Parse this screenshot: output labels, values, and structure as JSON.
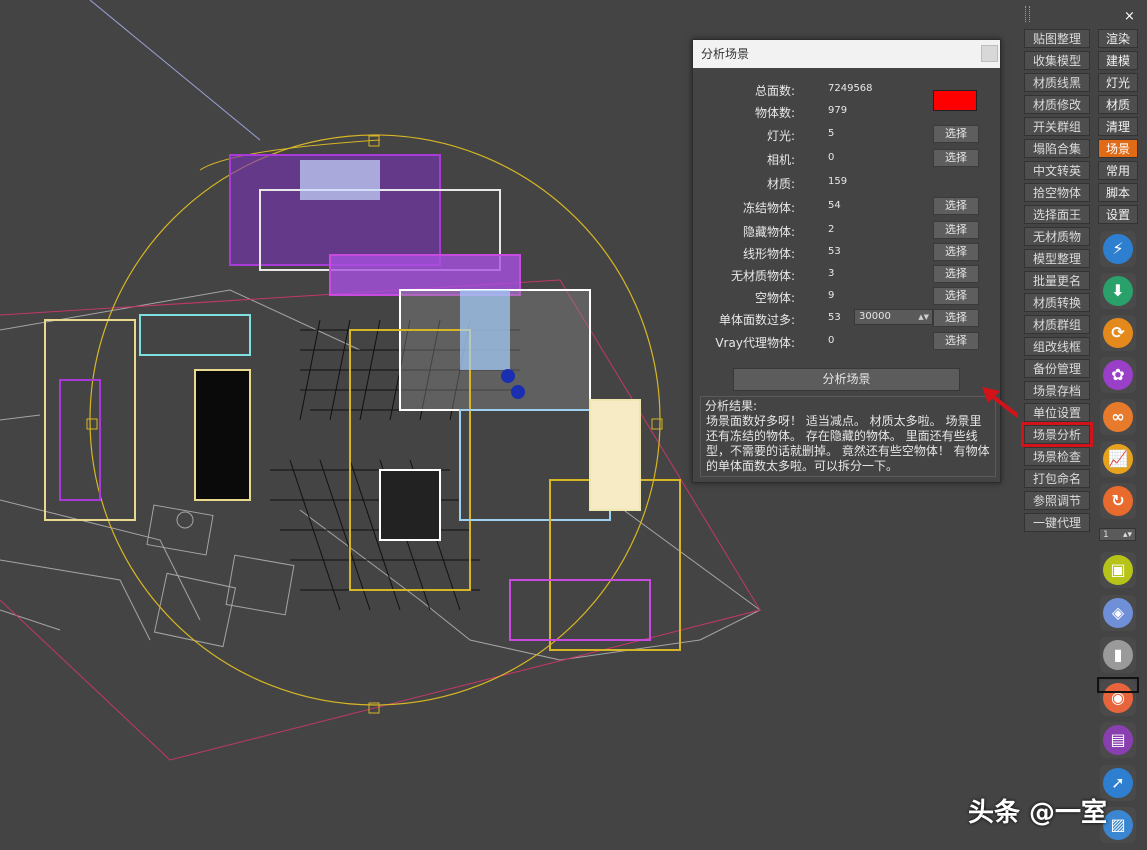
{
  "dialog": {
    "title": "分析场景",
    "rows": [
      {
        "label": "总面数:",
        "value": "7249568",
        "button": ""
      },
      {
        "label": "物体数:",
        "value": "979",
        "button": ""
      },
      {
        "label": "灯光:",
        "value": "5",
        "button": "选择"
      },
      {
        "label": "相机:",
        "value": "0",
        "button": "选择"
      },
      {
        "label": "材质:",
        "value": "159",
        "button": ""
      },
      {
        "label": "冻结物体:",
        "value": "54",
        "button": "选择"
      },
      {
        "label": "隐藏物体:",
        "value": "2",
        "button": "选择"
      },
      {
        "label": "线形物体:",
        "value": "53",
        "button": "选择"
      },
      {
        "label": "无材质物体:",
        "value": "3",
        "button": "选择"
      },
      {
        "label": "空物体:",
        "value": "9",
        "button": "选择"
      },
      {
        "label": "单体面数过多:",
        "value": "53",
        "button": "选择",
        "threshold": "30000"
      },
      {
        "label": "Vray代理物体:",
        "value": "0",
        "button": "选择"
      }
    ],
    "analyze_label": "分析场景",
    "result_title": "分析结果:",
    "result_text": "场景面数好多呀！ 适当减点。 材质太多啦。 场景里还有冻结的物体。  存在隐藏的物体。 里面还有些线型，不需要的话就删掉。 竟然还有些空物体！ 有物体的单体面数太多啦。可以拆分一下。",
    "swatch_color": "#ff0000"
  },
  "panel": {
    "close": "×",
    "tools_left": [
      "贴图整理",
      "收集模型",
      "材质线黑",
      "材质修改",
      "开关群组",
      "塌陷合集",
      "中文转英",
      "拾空物体",
      "选择面王",
      "无材质物",
      "模型整理",
      "批量更名",
      "材质转换",
      "材质群组",
      "组改线框",
      "备份管理",
      "场景存档",
      "单位设置",
      "场景分析",
      "场景检查",
      "打包命名",
      "参照调节",
      "一键代理"
    ],
    "selected_tool": "场景分析",
    "tools_right": [
      "渲染",
      "建模",
      "灯光",
      "材质",
      "清理",
      "场景",
      "常用",
      "脚本",
      "设置"
    ],
    "active_right": "场景",
    "page_value": "1",
    "icons_top": [
      {
        "name": "lightning-icon",
        "color": "#2f7fd0",
        "glyph": "⚡"
      },
      {
        "name": "download-icon",
        "color": "#2aa06a",
        "glyph": "⬇"
      },
      {
        "name": "refresh-icon",
        "color": "#e48a1c",
        "glyph": "⟳"
      },
      {
        "name": "flower-icon",
        "color": "#9a3fc7",
        "glyph": "✿"
      },
      {
        "name": "link-icon",
        "color": "#e87a2c",
        "glyph": "∞"
      },
      {
        "name": "chart-icon",
        "color": "#e6a21c",
        "glyph": "📈"
      },
      {
        "name": "cycle-icon",
        "color": "#e86a2c",
        "glyph": "↻"
      }
    ],
    "icons_bottom": [
      {
        "name": "image-icon",
        "color": "#b6c41a",
        "glyph": "▣"
      },
      {
        "name": "cube-icon",
        "color": "#6f8fd8",
        "glyph": "◈"
      },
      {
        "name": "usb-icon",
        "color": "#9a9a9a",
        "glyph": "▮"
      },
      {
        "name": "camera-icon",
        "color": "#e8643c",
        "glyph": "◉"
      },
      {
        "name": "sd-card-icon",
        "color": "#8a3fb0",
        "glyph": "▤"
      },
      {
        "name": "arrow-icon",
        "color": "#2f7fd0",
        "glyph": "➚"
      },
      {
        "name": "ruler-icon",
        "color": "#3a86d0",
        "glyph": "▨"
      }
    ]
  },
  "watermark": "头条 @一室"
}
